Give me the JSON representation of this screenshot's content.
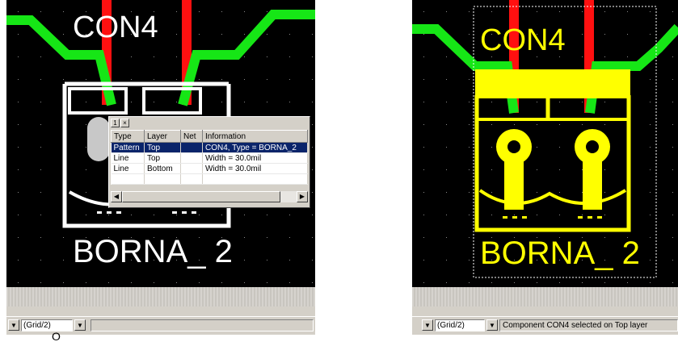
{
  "colors": {
    "trace_red": "#ff1010",
    "trace_green": "#16e616",
    "silkscreen_white": "#ffffff",
    "selected_yellow": "#ffff00",
    "selection_highlight": "#0a246a"
  },
  "left_view": {
    "component_label": "CON4",
    "footprint_label": "BORNA_ 2",
    "inspector": {
      "close_icon_glyph": "×",
      "pin_icon_glyph": "1",
      "columns": [
        "Type",
        "Layer",
        "Net",
        "Information"
      ],
      "rows": [
        {
          "type": "Pattern",
          "layer": "Top",
          "net": "",
          "info": "CON4, Type = BORNA_2",
          "selected": true
        },
        {
          "type": "Line",
          "layer": "Top",
          "net": "",
          "info": "Width = 30.0mil",
          "selected": false
        },
        {
          "type": "Line",
          "layer": "Bottom",
          "net": "",
          "info": "Width = 30.0mil",
          "selected": false
        }
      ]
    },
    "status": {
      "grid_value": "(Grid/2)",
      "message": ""
    }
  },
  "right_view": {
    "component_label": "CON4",
    "footprint_label": "BORNA_ 2",
    "status": {
      "grid_value": "(Grid/2)",
      "message": "Component CON4 selected on Top layer"
    }
  },
  "cursor_glyph": "O"
}
